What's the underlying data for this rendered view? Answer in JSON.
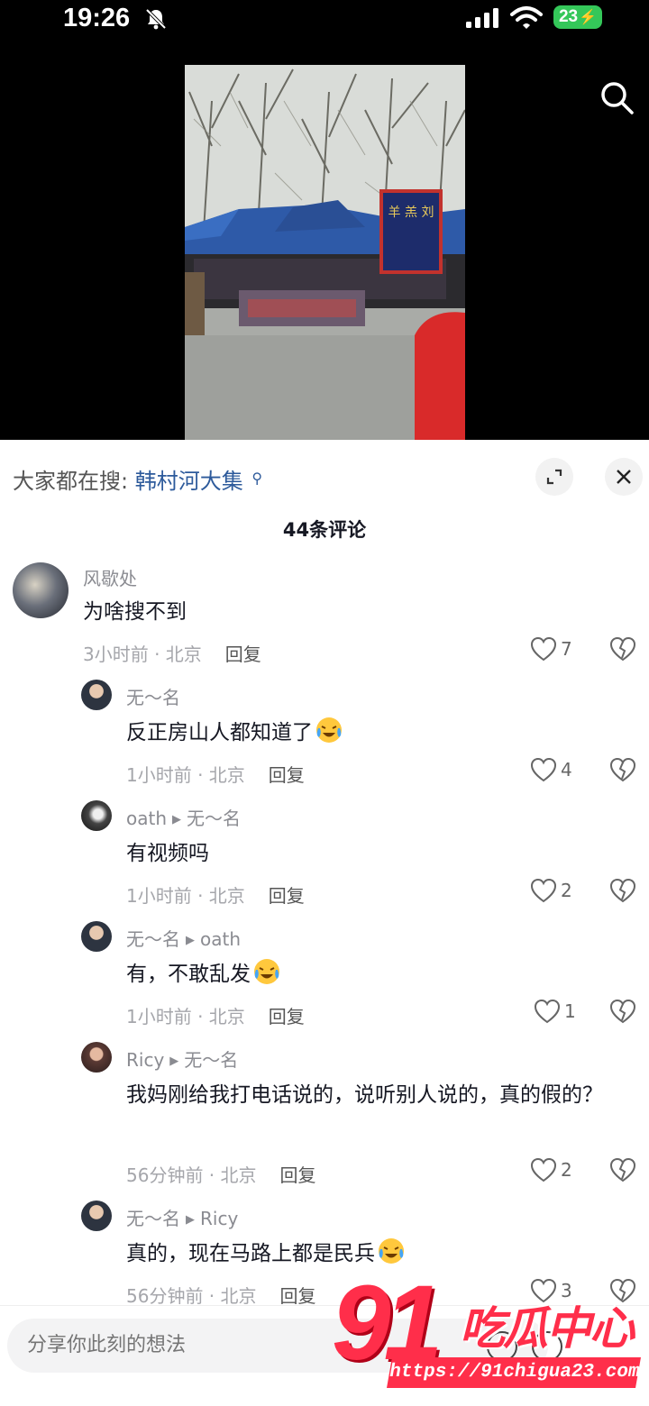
{
  "status_bar": {
    "time": "19:26",
    "battery": "23",
    "icons": [
      "bell-off-icon",
      "signal-icon",
      "wifi-icon",
      "battery-charging-icon"
    ]
  },
  "video": {
    "search_icon": "search-icon",
    "sign_text": "羊 羔 刘"
  },
  "panel": {
    "hot_search_prefix": "大家都在搜:",
    "hot_search_keyword": "韩村河大集",
    "comment_count": "44条评论"
  },
  "comments": [
    {
      "author": "风歇处",
      "reply_to": "",
      "text": "为啥搜不到",
      "emoji": "",
      "time_location": "3小时前 · 北京",
      "reply_label": "回复",
      "likes": "7"
    },
    {
      "author": "无～名",
      "reply_to": "",
      "text": "反正房山人都知道了",
      "emoji": "laughing-crying-emoji",
      "time_location": "1小时前 · 北京",
      "reply_label": "回复",
      "likes": "4"
    },
    {
      "author": "oath",
      "reply_to": "无～名",
      "text": "有视频吗",
      "emoji": "",
      "time_location": "1小时前 · 北京",
      "reply_label": "回复",
      "likes": "2"
    },
    {
      "author": "无～名",
      "reply_to": "oath",
      "text": "有，不敢乱发",
      "emoji": "laughing-crying-emoji",
      "time_location": "1小时前 · 北京",
      "reply_label": "回复",
      "likes": "1"
    },
    {
      "author": "Ricy",
      "reply_to": "无～名",
      "text": "我妈刚给我打电话说的，说听别人说的，真的假的？",
      "emoji": "",
      "time_location": "56分钟前 · 北京",
      "reply_label": "回复",
      "likes": "2"
    },
    {
      "author": "无～名",
      "reply_to": "Ricy",
      "text": "真的，现在马路上都是民兵",
      "emoji": "laughing-crying-emoji",
      "time_location": "56分钟前 · 北京",
      "reply_label": "回复",
      "likes": "3"
    }
  ],
  "input": {
    "placeholder": "分享你此刻的想法"
  },
  "watermark": {
    "number": "91",
    "title": "吃瓜中心",
    "url": "https://91chigua23.com"
  }
}
